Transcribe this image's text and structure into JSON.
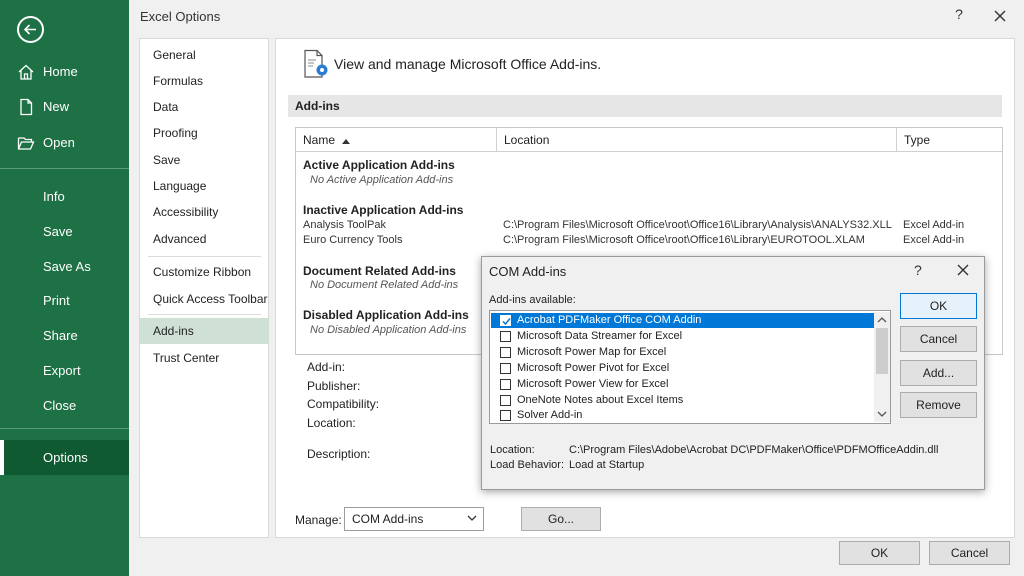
{
  "backstage": {
    "items": [
      {
        "label": "Home",
        "icon": "home-icon"
      },
      {
        "label": "New",
        "icon": "new-document-icon"
      },
      {
        "label": "Open",
        "icon": "folder-open-icon"
      },
      {
        "label": "Info"
      },
      {
        "label": "Save"
      },
      {
        "label": "Save As"
      },
      {
        "label": "Print"
      },
      {
        "label": "Share"
      },
      {
        "label": "Export"
      },
      {
        "label": "Close"
      },
      {
        "label": "Options"
      }
    ],
    "accent": "#1e7145"
  },
  "dialog": {
    "title": "Excel Options",
    "help": "?",
    "nav": [
      "General",
      "Formulas",
      "Data",
      "Proofing",
      "Save",
      "Language",
      "Accessibility",
      "Advanced",
      "Customize Ribbon",
      "Quick Access Toolbar",
      "Add-ins",
      "Trust Center"
    ],
    "active_nav": "Add-ins",
    "header": "View and manage Microsoft Office Add-ins.",
    "section": "Add-ins",
    "table": {
      "columns": [
        "Name",
        "Location",
        "Type"
      ],
      "groups": [
        {
          "title": "Active Application Add-ins",
          "empty": "No Active Application Add-ins"
        },
        {
          "title": "Inactive Application Add-ins",
          "rows": [
            {
              "name": "Analysis ToolPak",
              "location": "C:\\Program Files\\Microsoft Office\\root\\Office16\\Library\\Analysis\\ANALYS32.XLL",
              "type": "Excel Add-in"
            },
            {
              "name": "Euro Currency Tools",
              "location": "C:\\Program Files\\Microsoft Office\\root\\Office16\\Library\\EUROTOOL.XLAM",
              "type": "Excel Add-in"
            }
          ]
        },
        {
          "title": "Document Related Add-ins",
          "empty": "No Document Related Add-ins"
        },
        {
          "title": "Disabled Application Add-ins",
          "empty": "No Disabled Application Add-ins"
        }
      ]
    },
    "details": {
      "addin": "Add-in:",
      "publisher": "Publisher:",
      "compatibility": "Compatibility:",
      "location": "Location:",
      "description": "Description:"
    },
    "manage": {
      "label": "Manage:",
      "value": "COM Add-ins",
      "go": "Go..."
    },
    "ok": "OK",
    "cancel": "Cancel"
  },
  "com": {
    "title": "COM Add-ins",
    "help": "?",
    "available_label": "Add-ins available:",
    "items": [
      {
        "label": "Acrobat PDFMaker Office COM Addin",
        "checked": true
      },
      {
        "label": "Microsoft Data Streamer for Excel",
        "checked": false
      },
      {
        "label": "Microsoft Power Map for Excel",
        "checked": false
      },
      {
        "label": "Microsoft Power Pivot for Excel",
        "checked": false
      },
      {
        "label": "Microsoft Power View for Excel",
        "checked": false
      },
      {
        "label": "OneNote Notes about Excel Items",
        "checked": false
      },
      {
        "label": "Solver Add-in",
        "checked": false
      }
    ],
    "location_label": "Location:",
    "location_value": "C:\\Program Files\\Adobe\\Acrobat DC\\PDFMaker\\Office\\PDFMOfficeAddin.dll",
    "behavior_label": "Load Behavior:",
    "behavior_value": "Load at Startup",
    "buttons": {
      "ok": "OK",
      "cancel": "Cancel",
      "add": "Add...",
      "remove": "Remove"
    }
  }
}
